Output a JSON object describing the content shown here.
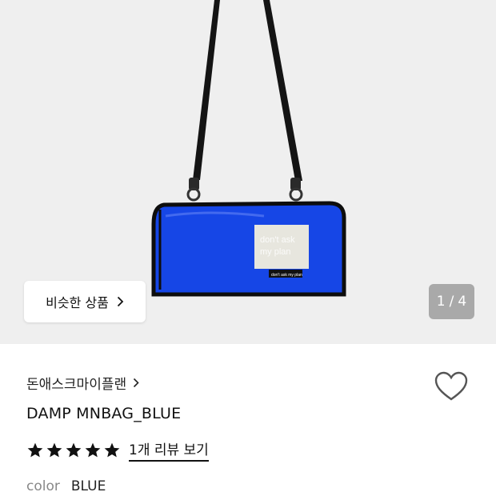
{
  "gallery": {
    "similar_button_label": "비슷한 상품",
    "pager_current": "1",
    "pager_separator": "/",
    "pager_total": "4",
    "bag": {
      "color": "#1646e6",
      "patch_text_line1": "don't ask",
      "patch_text_line2": "my plan",
      "tag_text": "don't ask my plan"
    }
  },
  "product": {
    "brand": "돈애스크마이플랜",
    "name": "DAMP MNBAG_BLUE",
    "rating": 5,
    "rating_max": 5,
    "review_link": "1개 리뷰 보기",
    "color_label": "color",
    "color_value": "BLUE",
    "liked": false
  },
  "icons": {
    "chevron": "chevron-right-icon",
    "heart": "heart-outline-icon",
    "star": "star-filled-icon"
  }
}
